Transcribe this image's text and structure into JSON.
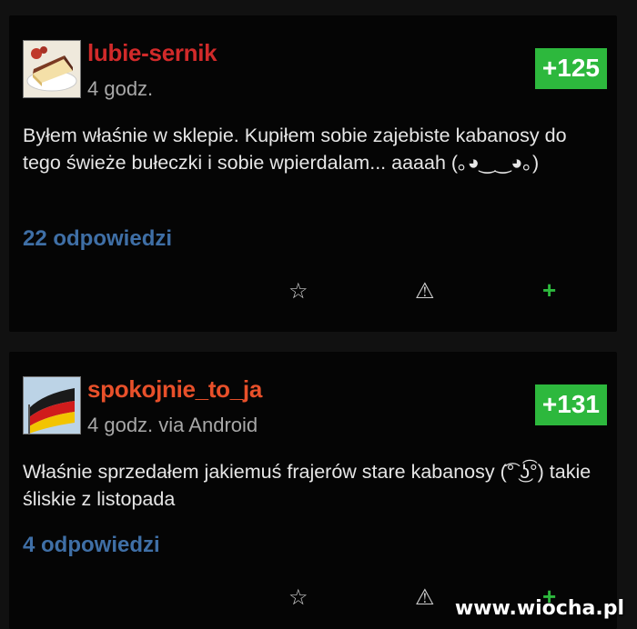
{
  "comments": [
    {
      "username": "lubie-sernik",
      "username_color": "#d12a2a",
      "meta": "4 godz.",
      "score": "+125",
      "text": "Byłem właśnie w sklepie. Kupiłem sobie zajebiste kabanosy do tego świeże bułeczki i sobie wpierdalam... aaaah (｡◕‿‿◕｡)",
      "replies": "22 odpowiedzi",
      "avatar_icon": "cheesecake-avatar",
      "actions": {
        "favorite": "☆",
        "report": "⚠",
        "plus": "+"
      }
    },
    {
      "username": "spokojnie_to_ja",
      "username_color": "#e8502a",
      "meta": "4 godz. via Android",
      "score": "+131",
      "text": "Właśnie sprzedałem jakiemuś frajerów stare kabanosy (͡° ͜ʖ͡°) takie śliskie z listopada",
      "replies": "4 odpowiedzi",
      "avatar_icon": "german-flag-avatar",
      "actions": {
        "favorite": "☆",
        "report": "⚠",
        "plus": "+"
      }
    }
  ],
  "watermark": "www.wiocha.pl",
  "colors": {
    "score_bg": "#2db83d",
    "reply_link": "#3f6fa6",
    "card_bg": "#050505"
  }
}
